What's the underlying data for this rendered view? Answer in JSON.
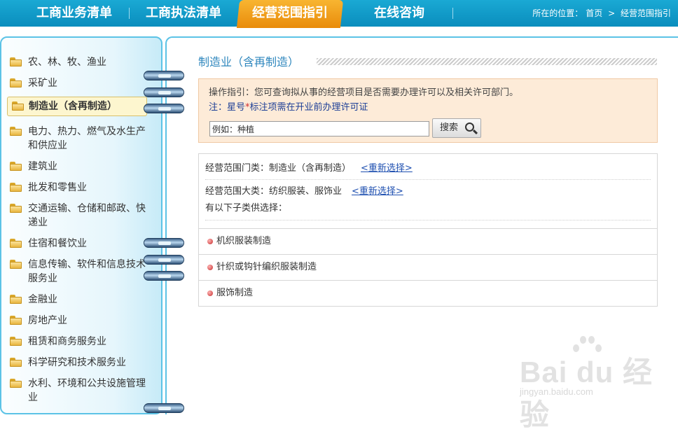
{
  "topnav": {
    "tabs": [
      {
        "label": "工商业务清单"
      },
      {
        "label": "工商执法清单"
      },
      {
        "label": "经营范围指引",
        "active": true
      },
      {
        "label": "在线咨询"
      }
    ],
    "breadcrumb": {
      "prefix": "所在的位置：",
      "home": "首页",
      "separator": ">",
      "current": "经营范围指引"
    }
  },
  "sidebar": {
    "items": [
      {
        "label": "农、林、牧、渔业"
      },
      {
        "label": "采矿业"
      },
      {
        "label": "制造业（含再制造）",
        "active": true
      },
      {
        "label": "电力、热力、燃气及水生产和供应业"
      },
      {
        "label": "建筑业"
      },
      {
        "label": "批发和零售业"
      },
      {
        "label": "交通运输、仓储和邮政、快递业"
      },
      {
        "label": "住宿和餐饮业"
      },
      {
        "label": "信息传输、软件和信息技术服务业"
      },
      {
        "label": "金融业"
      },
      {
        "label": "房地产业"
      },
      {
        "label": "租赁和商务服务业"
      },
      {
        "label": "科学研究和技术服务业"
      },
      {
        "label": "水利、环境和公共设施管理业"
      }
    ]
  },
  "main": {
    "title": "制造业（含再制造）",
    "guide": {
      "text": "操作指引：您可查询拟从事的经营项目是否需要办理许可以及相关许可部门。",
      "note_prefix": "注：星号",
      "note_star": "*",
      "note_suffix": "标注项需在开业前办理许可证",
      "search_value": "例如：种植",
      "search_button": "搜索"
    },
    "result": {
      "category_label": "经营范围门类：制造业（含再制造）",
      "major_label": "经营范围大类：纺织服装、服饰业",
      "reselect": "<重新选择>",
      "subclass_prompt": "有以下子类供选择：",
      "subclasses": [
        {
          "label": "机织服装制造"
        },
        {
          "label": "针织或钩针编织服装制造"
        },
        {
          "label": "服饰制造"
        }
      ]
    }
  },
  "watermark": {
    "logo_text": "Bai du 经验",
    "url": "jingyan.baidu.com"
  }
}
